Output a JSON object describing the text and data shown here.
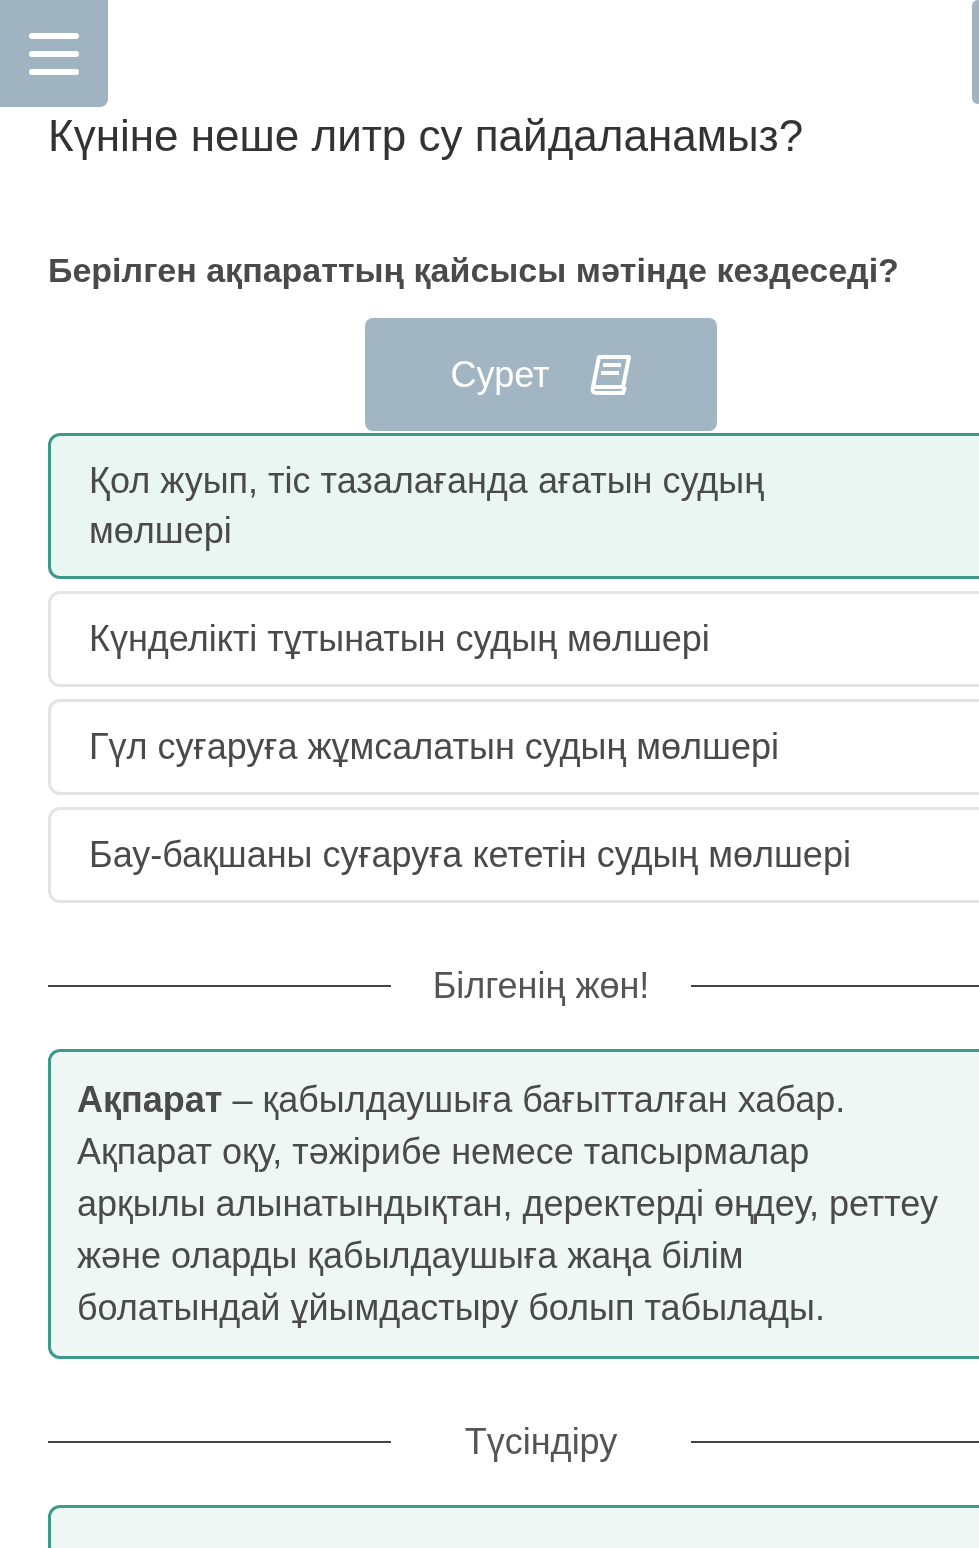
{
  "title": "Күніне неше литр су пайдаланамыз?",
  "question": "Берілген ақпараттың қайсысы мәтінде кездеседі?",
  "image_button": {
    "label": "Сурет"
  },
  "options": [
    {
      "text": "Қол жуып, тіс тазалағанда ағатын судың мөлшері",
      "selected": true
    },
    {
      "text": "Күнделікті тұтынатын судың мөлшері",
      "selected": false
    },
    {
      "text": "Гүл суғаруға жұмсалатын судың мөлшері",
      "selected": false
    },
    {
      "text": "Бау-бақшаны суғаруға кететін судың мөлшері",
      "selected": false
    }
  ],
  "did_you_know": {
    "heading": "Білгенің жөн!",
    "text": "**Ақпарат** – қабылдаушыға бағытталған хабар. Ақпарат оқу, тәжірибе немесе тапсырмалар арқылы алынатындықтан, деректерді өңдеу, реттеу және оларды қабылдаушыға жаңа білім болатындай ұйымдастыру болып табылады."
  },
  "explanation": {
    "heading": "Түсіндіру"
  }
}
